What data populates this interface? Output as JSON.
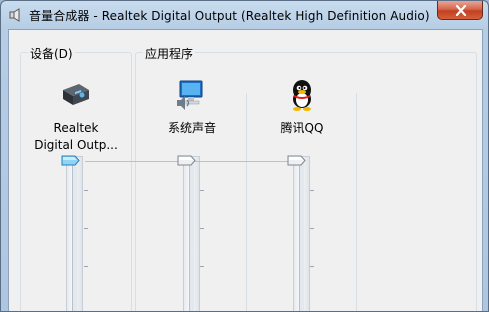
{
  "window": {
    "title": "音量合成器 - Realtek Digital Output (Realtek High Definition Audio)",
    "close_icon": "close-icon"
  },
  "devices": {
    "label": "设备(D)",
    "items": [
      {
        "line1": "Realtek",
        "line2": "Digital Outp...",
        "icon": "speaker-device-icon",
        "volume_level": 1.0
      }
    ]
  },
  "applications": {
    "label": "应用程序",
    "items": [
      {
        "name": "系统声音",
        "icon": "system-sounds-icon",
        "volume_level": 1.0
      },
      {
        "name": "腾讯QQ",
        "icon": "qq-penguin-icon",
        "volume_level": 1.0
      }
    ]
  },
  "colors": {
    "titlebar": "#b6cde4",
    "close_button": "#c9472b",
    "client_background": "#f0f0f0",
    "group_border": "#d5dfe5",
    "slider_track": "#e6eaee"
  }
}
